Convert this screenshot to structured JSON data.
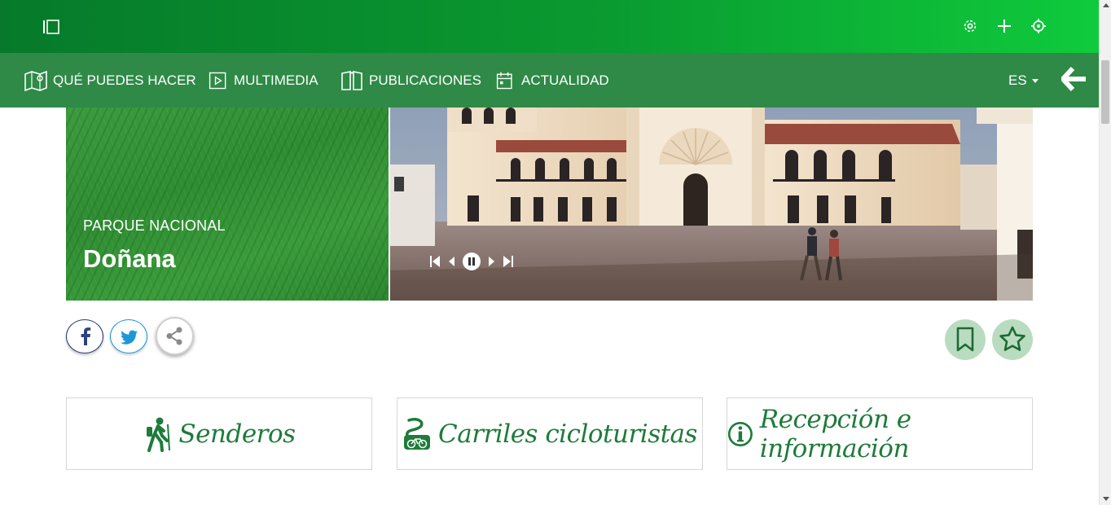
{
  "topbar": {
    "icons": [
      "sidebar-toggle-icon",
      "settings-icon",
      "plus-icon",
      "crosshair-icon"
    ]
  },
  "nav": {
    "items": [
      {
        "label": "QUÉ PUEDES HACER",
        "icon": "map-pin-icon"
      },
      {
        "label": "MULTIMEDIA",
        "icon": "play-icon"
      },
      {
        "label": "PUBLICACIONES",
        "icon": "book-icon"
      },
      {
        "label": "ACTUALIDAD",
        "icon": "calendar-icon"
      }
    ],
    "language": "ES",
    "back_icon": "arrow-left-icon"
  },
  "hero": {
    "kicker": "PARQUE NACIONAL",
    "title": "Doñana",
    "slider_controls": [
      "first-icon",
      "prev-icon",
      "pause-icon",
      "next-icon",
      "last-icon"
    ]
  },
  "social": {
    "buttons": [
      "facebook-icon",
      "twitter-icon",
      "share-icon"
    ],
    "actions": [
      "bookmark-icon",
      "star-icon"
    ]
  },
  "cards": [
    {
      "label": "Senderos",
      "icon": "hiker-icon"
    },
    {
      "label": "Carriles cicloturistas",
      "icon": "bicycle-icon"
    },
    {
      "label": "Recepción e información",
      "icon": "info-icon"
    }
  ],
  "colors": {
    "topbar_start": "#067a2a",
    "topbar_end": "#0fcb3c",
    "navbar": "#2e8a46",
    "accent": "#1e7b3a",
    "fav_bg": "#b9dcc0"
  }
}
